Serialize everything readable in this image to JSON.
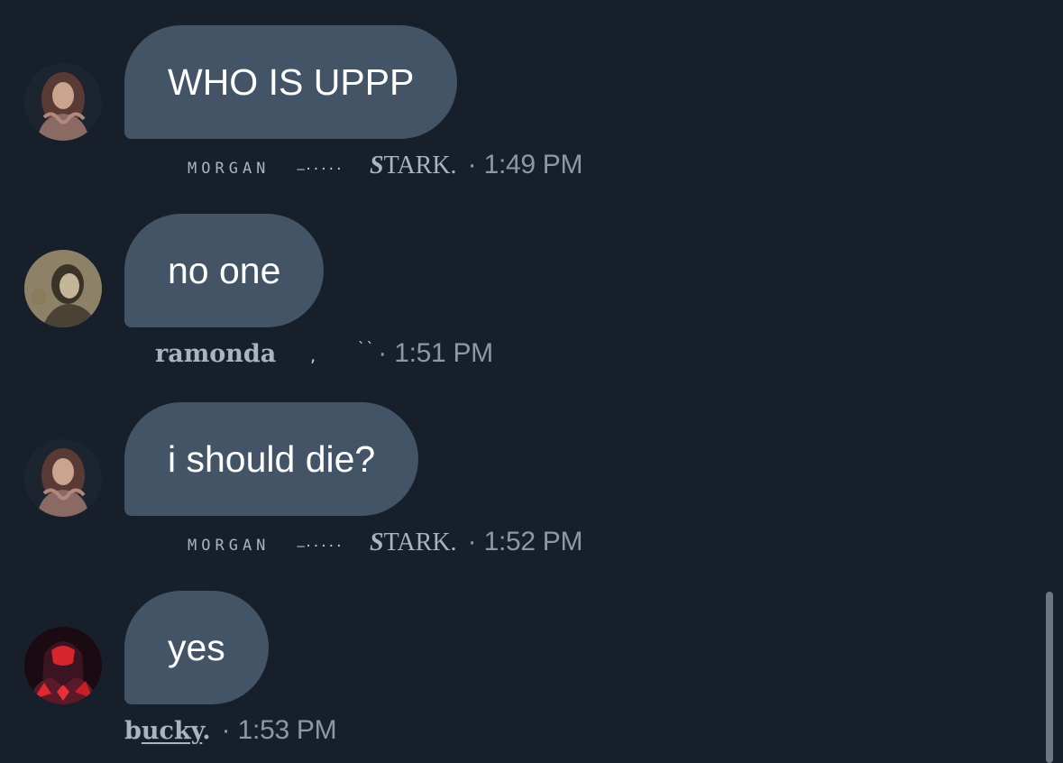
{
  "colors": {
    "background": "#17202a",
    "bubble": "#425466",
    "bubble_text": "#ffffff",
    "meta_text": "#8b98a5",
    "scrollbar": "#6c7680"
  },
  "messages": [
    {
      "text": "WHO IS UPPP",
      "avatar_icon": "avatar-woman-curly-hair",
      "sender": {
        "part1": "MORGAN",
        "dash": "—·····",
        "part2_first": "S",
        "part2_rest": "TARK."
      },
      "dot": "·",
      "time": "1:49 PM"
    },
    {
      "text": "no one",
      "avatar_icon": "avatar-sepia-portrait",
      "sender": {
        "name": "ramonda",
        "mark1": ",",
        "mark2": "``"
      },
      "dot": "·",
      "time": "1:51 PM"
    },
    {
      "text": "i should die?",
      "avatar_icon": "avatar-woman-curly-hair",
      "sender": {
        "part1": "MORGAN",
        "dash": "—·····",
        "part2_first": "S",
        "part2_rest": "TARK."
      },
      "dot": "·",
      "time": "1:52 PM"
    },
    {
      "text": "yes",
      "avatar_icon": "avatar-red-masked-figure",
      "sender": {
        "first": "b",
        "rest": "ucky",
        "suffix": "."
      },
      "dot": "·",
      "time": "1:53 PM"
    }
  ]
}
